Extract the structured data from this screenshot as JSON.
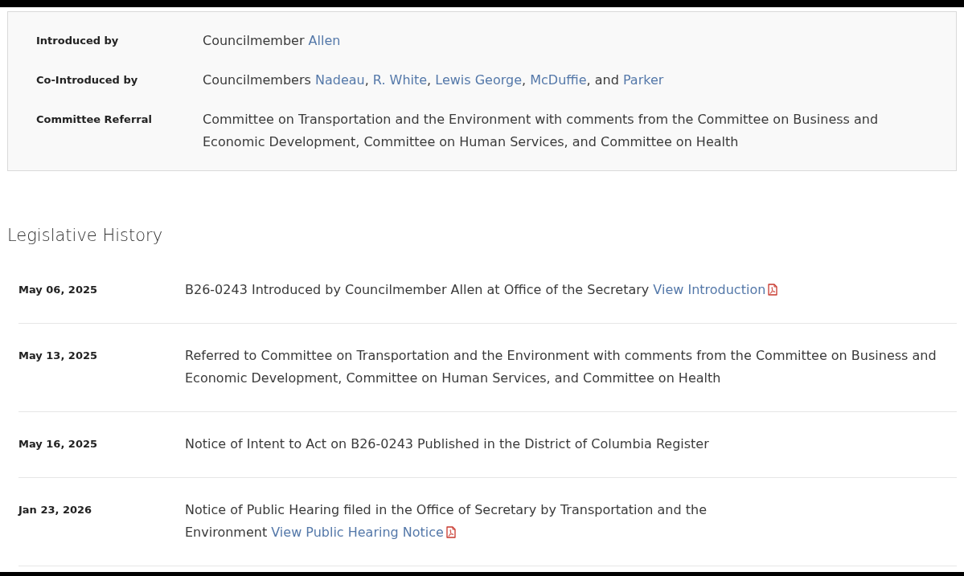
{
  "sponsor_details": [
    {
      "label": "Introduced by",
      "value": [
        {
          "kind": "text",
          "text": "Councilmember "
        },
        {
          "kind": "link",
          "text": "Allen"
        }
      ]
    },
    {
      "label": "Co-Introduced by",
      "value": [
        {
          "kind": "text",
          "text": "Councilmembers "
        },
        {
          "kind": "link",
          "text": "Nadeau"
        },
        {
          "kind": "text",
          "text": ", "
        },
        {
          "kind": "link",
          "text": "R. White"
        },
        {
          "kind": "text",
          "text": ", "
        },
        {
          "kind": "link",
          "text": "Lewis George"
        },
        {
          "kind": "text",
          "text": ", "
        },
        {
          "kind": "link",
          "text": "McDuffie"
        },
        {
          "kind": "text",
          "text": ", and "
        },
        {
          "kind": "link",
          "text": "Parker"
        }
      ]
    },
    {
      "label": "Committee Referral",
      "value": [
        {
          "kind": "text",
          "text": "Committee on Transportation and the Environment with comments from the Committee on Business and Economic Development, Committee on Human Services, and Committee on Health"
        }
      ]
    }
  ],
  "legislative_history": {
    "title": "Legislative History",
    "entries": [
      {
        "date": "May 06, 2025",
        "description": [
          {
            "kind": "text",
            "text": "B26-0243 Introduced by Councilmember Allen at Office of the Secretary "
          },
          {
            "kind": "pdf_link",
            "text": "View Introduction"
          }
        ]
      },
      {
        "date": "May 13, 2025",
        "description": [
          {
            "kind": "text",
            "text": "Referred to Committee on Transportation and the Environment with comments from the Committee on Business and Economic Development, Committee on Human Services, and Committee on Health"
          }
        ]
      },
      {
        "date": "May 16, 2025",
        "description": [
          {
            "kind": "text",
            "text": "Notice of Intent to Act on B26-0243 Published in the District of Columbia Register"
          }
        ]
      },
      {
        "date": "Jan 23, 2026",
        "description": [
          {
            "kind": "text",
            "text": "Notice of Public Hearing filed in the Office of Secretary by Transportation and the Environment "
          },
          {
            "kind": "pdf_link",
            "text": "View Public Hearing Notice"
          }
        ]
      }
    ]
  }
}
